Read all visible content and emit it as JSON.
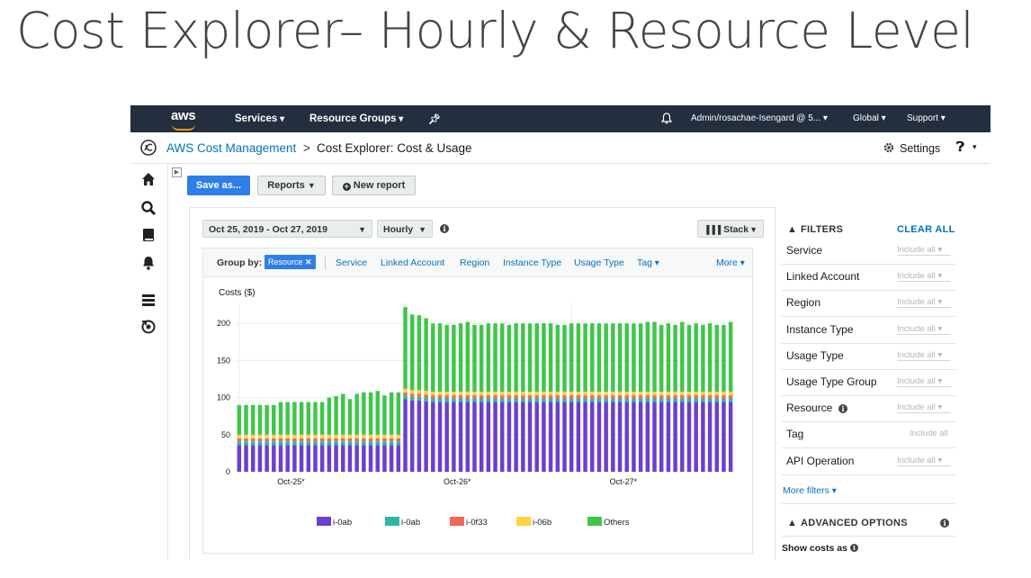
{
  "slide_title": "Cost Explorer– Hourly & Resource Level",
  "topnav": {
    "logo": "aws",
    "services": "Services",
    "resource_groups": "Resource Groups",
    "account": "Admin/rosachae-Isengard @ 5...",
    "region": "Global",
    "support": "Support"
  },
  "breadcrumb": {
    "root": "AWS Cost Management",
    "separator": ">",
    "current": "Cost Explorer: Cost & Usage",
    "settings": "Settings"
  },
  "toolbar": {
    "save_as": "Save as...",
    "reports": "Reports",
    "new_report": "New report"
  },
  "controls": {
    "date_range": "Oct 25, 2019 - Oct 27, 2019",
    "granularity": "Hourly",
    "chart_style": "Stack"
  },
  "group_by": {
    "label": "Group by:",
    "selected": "Resource",
    "options": [
      "Service",
      "Linked Account",
      "Region",
      "Instance Type",
      "Usage Type",
      "Tag"
    ],
    "more": "More"
  },
  "filters": {
    "heading": "FILTERS",
    "clear_all": "CLEAR ALL",
    "items": [
      {
        "label": "Service",
        "value": "Include all"
      },
      {
        "label": "Linked Account",
        "value": "Include all"
      },
      {
        "label": "Region",
        "value": "Include all"
      },
      {
        "label": "Instance Type",
        "value": "Include all"
      },
      {
        "label": "Usage Type",
        "value": "Include all"
      },
      {
        "label": "Usage Type Group",
        "value": "Include all"
      },
      {
        "label": "Resource",
        "value": "Include all"
      },
      {
        "label": "Tag",
        "value": "Include all"
      },
      {
        "label": "API Operation",
        "value": "Include all"
      }
    ],
    "more_filters": "More filters",
    "advanced_heading": "ADVANCED OPTIONS",
    "show_costs_as": "Show costs as"
  },
  "colors": {
    "nav_bg": "#232f3e",
    "accent_orange": "#ff9900",
    "link_blue": "#0073bb",
    "primary_button": "#2f7ee8"
  },
  "chart_data": {
    "type": "bar",
    "stacked": true,
    "ylabel": "Costs ($)",
    "ylim": [
      0,
      250
    ],
    "yticks": [
      0,
      50,
      100,
      150,
      200
    ],
    "x_tick_labels": [
      "Oct-25*",
      "Oct-26*",
      "Oct-27*"
    ],
    "grid": true,
    "legend_position": "bottom",
    "categories_count": 72,
    "series": [
      {
        "name": "i-0ab",
        "color": "#6b3fcf",
        "values": [
          36,
          36,
          36,
          36,
          36,
          36,
          36,
          36,
          36,
          36,
          36,
          36,
          36,
          36,
          36,
          36,
          36,
          36,
          36,
          36,
          36,
          36,
          36,
          36,
          98,
          96,
          96,
          95,
          94,
          94,
          94,
          94,
          94,
          94,
          94,
          94,
          94,
          94,
          94,
          94,
          94,
          94,
          94,
          94,
          94,
          94,
          94,
          94,
          94,
          94,
          94,
          94,
          94,
          94,
          94,
          94,
          94,
          94,
          94,
          94,
          94,
          94,
          94,
          94,
          94,
          94,
          94,
          94,
          94,
          94,
          94,
          94
        ]
      },
      {
        "name": "i-0ab",
        "color": "#2fb5a4",
        "values": [
          5,
          5,
          5,
          5,
          5,
          5,
          5,
          5,
          5,
          5,
          5,
          5,
          5,
          5,
          5,
          5,
          5,
          5,
          5,
          5,
          5,
          5,
          5,
          5,
          5,
          5,
          5,
          5,
          5,
          5,
          5,
          5,
          5,
          5,
          5,
          5,
          5,
          5,
          5,
          5,
          5,
          5,
          5,
          5,
          5,
          5,
          5,
          5,
          5,
          5,
          5,
          5,
          5,
          5,
          5,
          5,
          5,
          5,
          5,
          5,
          5,
          5,
          5,
          5,
          5,
          5,
          5,
          5,
          5,
          5,
          5,
          5
        ]
      },
      {
        "name": "i-0f33",
        "color": "#f0685a",
        "values": [
          4,
          4,
          4,
          4,
          4,
          4,
          4,
          4,
          4,
          4,
          4,
          4,
          4,
          4,
          4,
          4,
          4,
          4,
          4,
          4,
          4,
          4,
          4,
          4,
          4,
          4,
          4,
          4,
          4,
          4,
          4,
          4,
          4,
          4,
          4,
          4,
          4,
          4,
          4,
          4,
          4,
          4,
          4,
          4,
          4,
          4,
          4,
          4,
          4,
          4,
          4,
          4,
          4,
          4,
          4,
          4,
          4,
          4,
          4,
          4,
          4,
          4,
          4,
          4,
          4,
          4,
          4,
          4,
          4,
          4,
          4,
          4
        ]
      },
      {
        "name": "i-06b",
        "color": "#ffd23f",
        "values": [
          5,
          5,
          5,
          5,
          5,
          5,
          5,
          5,
          5,
          5,
          5,
          5,
          5,
          5,
          5,
          5,
          5,
          5,
          5,
          5,
          5,
          5,
          5,
          5,
          5,
          5,
          5,
          5,
          5,
          5,
          5,
          5,
          5,
          5,
          5,
          5,
          5,
          5,
          5,
          5,
          5,
          5,
          5,
          5,
          5,
          5,
          5,
          5,
          5,
          5,
          5,
          5,
          5,
          5,
          5,
          5,
          5,
          5,
          5,
          5,
          5,
          5,
          5,
          5,
          5,
          5,
          5,
          5,
          5,
          5,
          5,
          5
        ]
      },
      {
        "name": "Others",
        "color": "#3fc64a",
        "values": [
          40,
          40,
          40,
          40,
          40,
          40,
          44,
          44,
          44,
          44,
          44,
          44,
          44,
          50,
          52,
          55,
          48,
          55,
          57,
          57,
          59,
          53,
          57,
          57,
          110,
          102,
          101,
          98,
          92,
          92,
          90,
          90,
          92,
          94,
          90,
          90,
          92,
          92,
          92,
          90,
          92,
          92,
          92,
          92,
          92,
          92,
          90,
          90,
          92,
          92,
          92,
          92,
          92,
          92,
          92,
          92,
          92,
          92,
          92,
          94,
          94,
          90,
          92,
          90,
          94,
          90,
          92,
          90,
          92,
          90,
          90,
          94
        ]
      }
    ]
  }
}
